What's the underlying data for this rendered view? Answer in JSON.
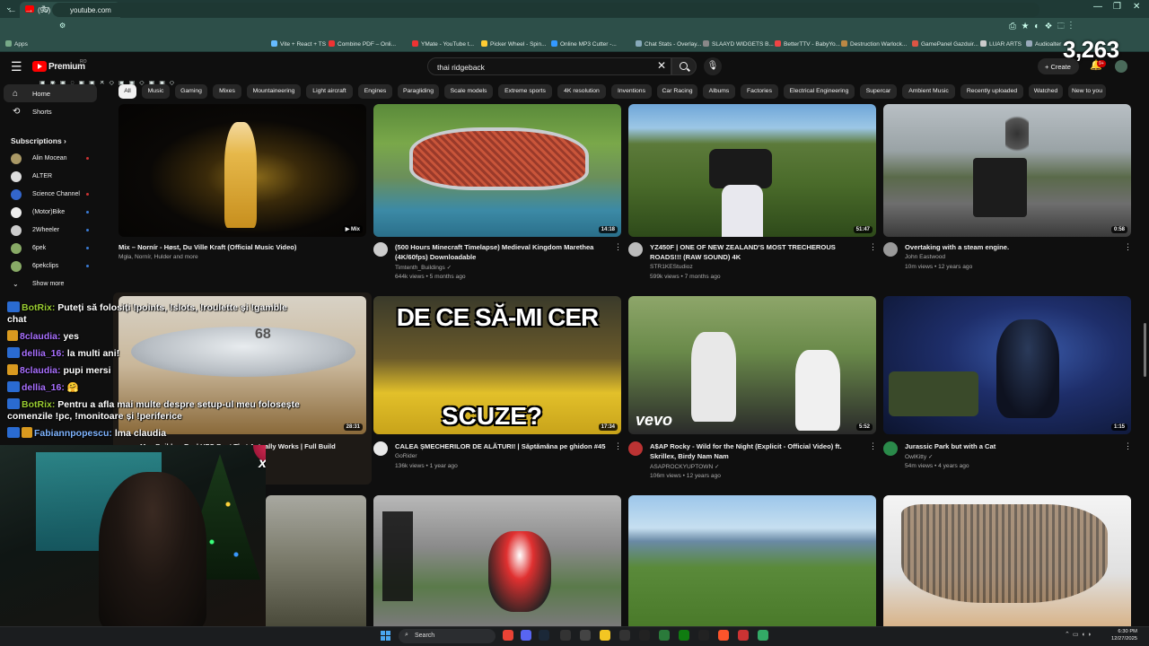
{
  "browser": {
    "tab_title": "(95) YouTube",
    "url": "youtube.com",
    "bookmarks": [
      "Apps",
      "Vite + React + TS",
      "Combine PDF – Onli...",
      "YMate - YouTube t...",
      "Picker Wheel - Spin...",
      "Online MP3 Cutter -...",
      "Chat Stats - Overlay...",
      "SLAAYD WIDGETS B...",
      "BetterTTV - BabyYo...",
      "Destruction Warlock...",
      "GamePanel Gazduir...",
      "LUAR ARTS",
      "Audioalter"
    ]
  },
  "header": {
    "logo_text": "Premium",
    "logo_region": "RO",
    "search_value": "thai ridgeback",
    "create_label": "Create",
    "notif_count": "9+"
  },
  "overlay": {
    "counter": "3,263"
  },
  "sidebar": {
    "home": "Home",
    "shorts": "Shorts",
    "subscriptions_heading": "Subscriptions",
    "subscriptions": [
      "Alin Mocean",
      "ALTER",
      "Science Channel",
      "(Motor)Bike",
      "2Wheeler",
      "6pek",
      "6pekclips"
    ],
    "show_more": "Show more"
  },
  "chips": [
    "All",
    "Music",
    "Gaming",
    "Mixes",
    "Mountaineering",
    "Light aircraft",
    "Engines",
    "Paragliding",
    "Scale models",
    "Extreme sports",
    "4K resolution",
    "Inventions",
    "Car Racing",
    "Albums",
    "Factories",
    "Electrical Engineering",
    "Supercar",
    "Ambient Music",
    "Recently uploaded",
    "Watched",
    "New to you"
  ],
  "videos": [
    {
      "title": "Mix – Nornír - Høst, Du Ville Kraft (Official Music Video)",
      "channel": "Mgła, Nornír, Hulder and more",
      "meta": "",
      "duration": "Mix"
    },
    {
      "title": "(500 Hours Minecraft Timelapse)  Medieval Kingdom Marethea (4K/60fps) Downloadable",
      "channel": "Timtenth_Buildings ✓",
      "meta": "644k views • 5 months ago",
      "duration": "14:18"
    },
    {
      "title": "YZ450F | ONE OF NEW ZEALAND'S MOST TRECHEROUS ROADS!!! (RAW SOUND) 4K",
      "channel": "STR1KEStudioz",
      "meta": "599k views • 7 months ago",
      "duration": "51:47"
    },
    {
      "title": "Overtaking with a steam engine.",
      "channel": "John Eastwood",
      "meta": "10m views • 12 years ago",
      "duration": "0:58"
    },
    {
      "title": "Man Builds a Real UFO Boat That Actually Works | Full Build",
      "channel": "",
      "meta": "",
      "duration": "28:31",
      "thumb_text": "68"
    },
    {
      "title": "CALEA ȘMECHERILOR DE ALĂTURI! | Săptămâna pe ghidon #45",
      "channel": "GoRider",
      "meta": "136k views • 1 year ago",
      "duration": "17:34",
      "thumb_top": "DE CE SĂ-MI CER",
      "thumb_bottom": "SCUZE?"
    },
    {
      "title": "A$AP Rocky - Wild for the Night (Explicit - Official Video) ft. Skrillex, Birdy Nam Nam",
      "channel": "ASAPROCKYUPTOWN ✓",
      "meta": "106m views • 12 years ago",
      "duration": "5:52",
      "thumb_text": "vevo"
    },
    {
      "title": "Jurassic Park but with a Cat",
      "channel": "OwlKitty ✓",
      "meta": "54m views • 4 years ago",
      "duration": "1:15"
    }
  ],
  "chat": [
    {
      "name": "BotRix:",
      "text": "Puteți să folosiți !points, !slots, !roulette și !gamble"
    },
    {
      "name": "chat",
      "text": ""
    },
    {
      "name": "8claudia:",
      "text": "yes"
    },
    {
      "name": "dellia_16:",
      "text": "la multi ani!"
    },
    {
      "name": "8claudia:",
      "text": "pupi mersi"
    },
    {
      "name": "dellia_16:",
      "text": "🤗"
    },
    {
      "name": "BotRix:",
      "text": "Pentru a afla mai multe despre setup-ul meu folosește comenzile !pc, !monitoare și !periferice"
    },
    {
      "name": "Fabiannpopescu:",
      "text": "lma claudia"
    }
  ],
  "chat_combo": "x2",
  "taskbar": {
    "search": "Search",
    "time": "6:30 PM",
    "date": "12/27/2025"
  }
}
